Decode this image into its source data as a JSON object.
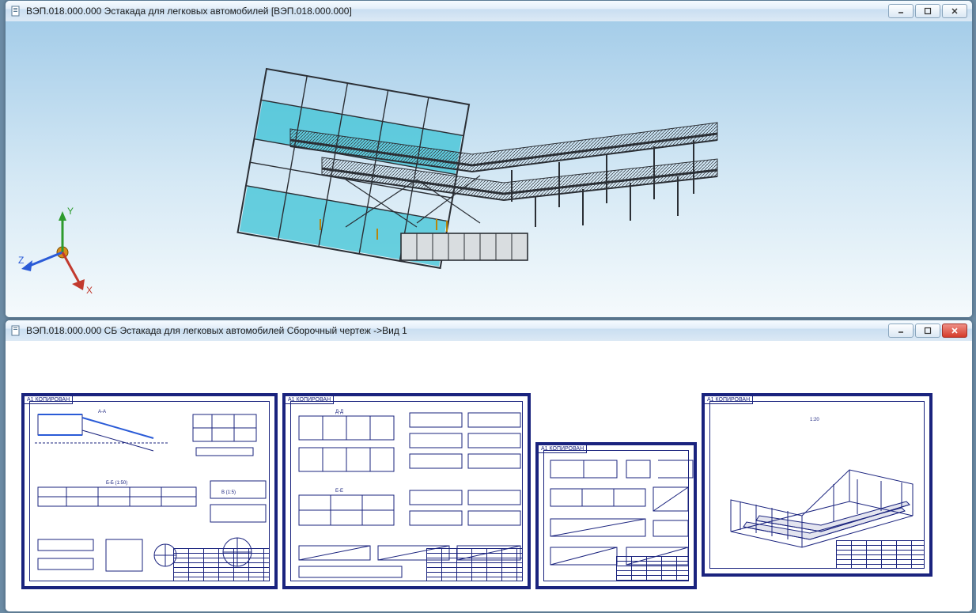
{
  "windows": {
    "top": {
      "title": "ВЭП.018.000.000 Эстакада для легковых автомобилей [ВЭП.018.000.000]",
      "axes": {
        "x": "X",
        "y": "Y",
        "z": "Z"
      }
    },
    "bottom": {
      "title": "ВЭП.018.000.000 СБ Эстакада для легковых автомобилей Сборочный чертеж ->Вид 1",
      "sheets": [
        {
          "format": "A1 КОПИРОВАН"
        },
        {
          "format": "A1 КОПИРОВАН"
        },
        {
          "format": "A1 КОПИРОВАН"
        },
        {
          "format": "A1 КОПИРОВАН"
        }
      ]
    }
  },
  "controls": {
    "minimize_tip": "Свернуть",
    "maximize_tip": "Развернуть",
    "close_tip": "Закрыть"
  },
  "model": {
    "panel_color": "#3cc3d6",
    "steel_color": "#4a5159"
  }
}
